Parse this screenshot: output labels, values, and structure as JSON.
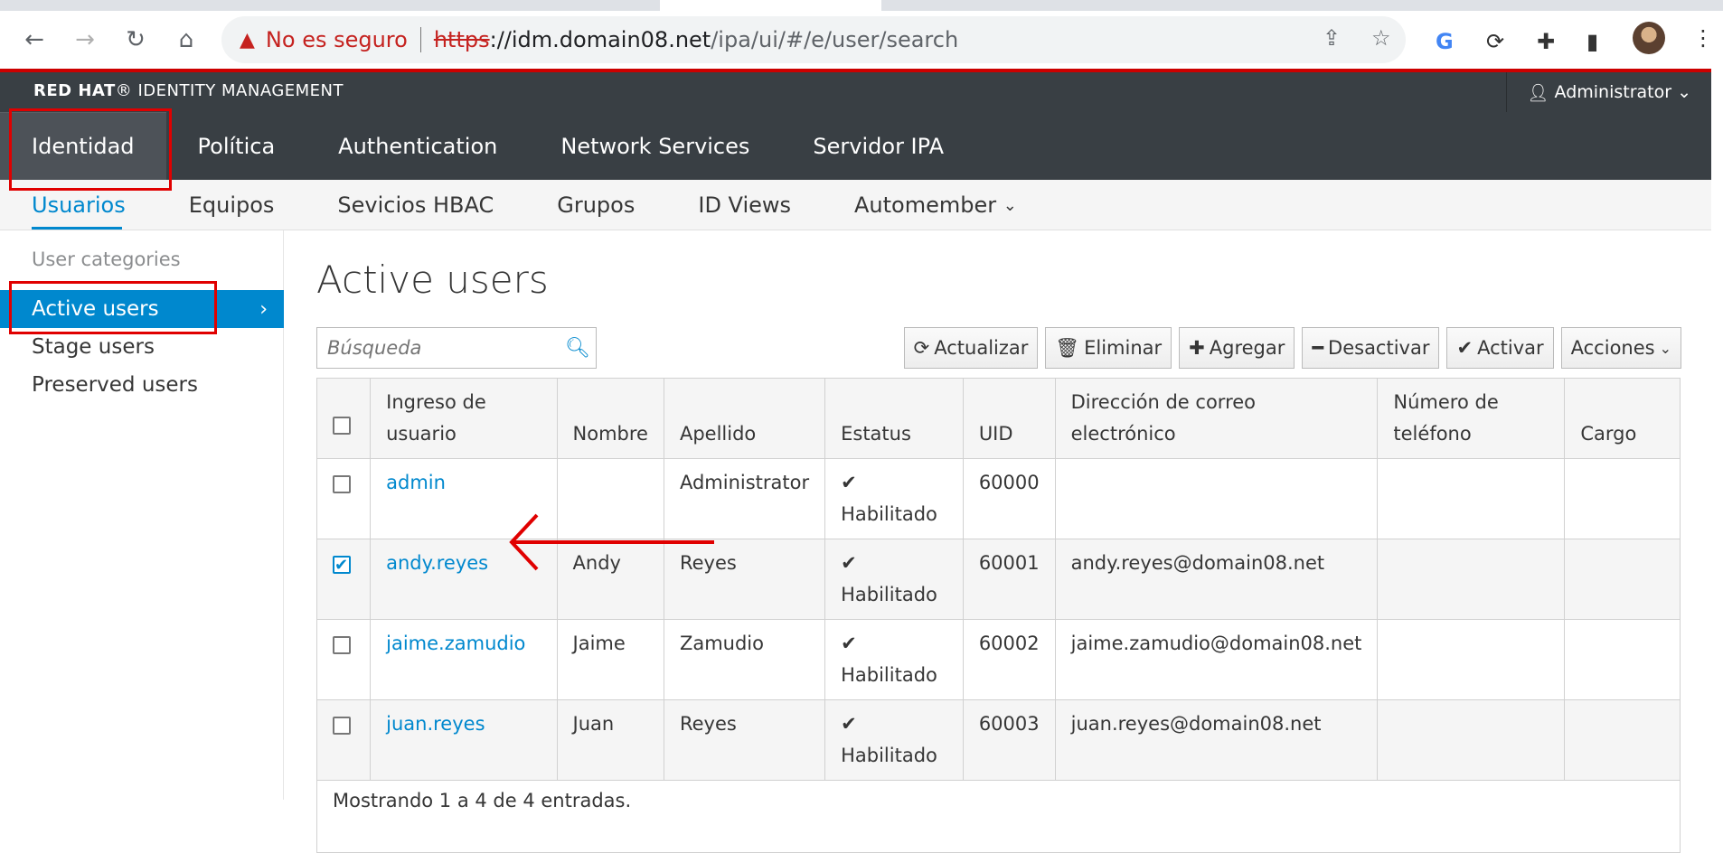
{
  "browser": {
    "not_secure": "No es seguro",
    "url_https": "https",
    "url_host": "://idm.domain08.net",
    "url_path": "/ipa/ui/#/e/user/search"
  },
  "header": {
    "brand_bold": "RED HAT",
    "brand_rest": "IDENTITY MANAGEMENT",
    "user": "Administrator"
  },
  "main_nav": [
    "Identidad",
    "Política",
    "Authentication",
    "Network Services",
    "Servidor IPA"
  ],
  "sub_nav": [
    "Usuarios",
    "Equipos",
    "Sevicios HBAC",
    "Grupos",
    "ID Views",
    "Automember"
  ],
  "sidebar": {
    "heading": "User categories",
    "items": [
      "Active users",
      "Stage users",
      "Preserved users"
    ]
  },
  "page": {
    "title": "Active users",
    "search_placeholder": "Búsqueda"
  },
  "toolbar": [
    "Actualizar",
    "Eliminar",
    "Agregar",
    "Desactivar",
    "Activar",
    "Acciones"
  ],
  "table": {
    "columns": [
      "Ingreso de usuario",
      "Nombre",
      "Apellido",
      "Estatus",
      "UID",
      "Dirección de correo electrónico",
      "Número de teléfono",
      "Cargo"
    ],
    "rows": [
      {
        "login": "admin",
        "first": "",
        "last": "Administrator",
        "status": "Habilitado",
        "uid": "60000",
        "email": "",
        "phone": "",
        "title": "",
        "checked": false
      },
      {
        "login": "andy.reyes",
        "first": "Andy",
        "last": "Reyes",
        "status": "Habilitado",
        "uid": "60001",
        "email": "andy.reyes@domain08.net",
        "phone": "",
        "title": "",
        "checked": true
      },
      {
        "login": "jaime.zamudio",
        "first": "Jaime",
        "last": "Zamudio",
        "status": "Habilitado",
        "uid": "60002",
        "email": "jaime.zamudio@domain08.net",
        "phone": "",
        "title": "",
        "checked": false
      },
      {
        "login": "juan.reyes",
        "first": "Juan",
        "last": "Reyes",
        "status": "Habilitado",
        "uid": "60003",
        "email": "juan.reyes@domain08.net",
        "phone": "",
        "title": "",
        "checked": false
      }
    ],
    "footer": "Mostrando 1 a 4 de 4 entradas."
  },
  "colors": {
    "accent": "#0088ce",
    "header_bg": "#393f44",
    "annotation_red": "#e00000"
  }
}
